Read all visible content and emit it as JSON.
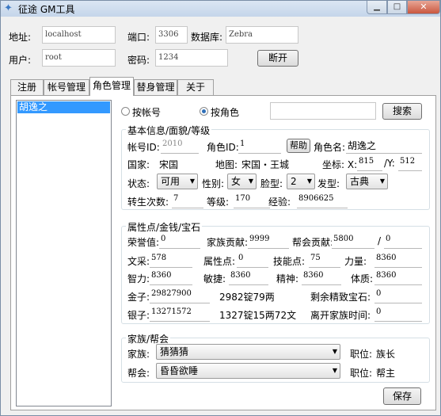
{
  "window": {
    "title": "征途 GM工具"
  },
  "connection": {
    "address_label": "地址:",
    "address_value": "localhost",
    "port_label": "端口:",
    "port_value": "3306",
    "db_label": "数据库:",
    "db_value": "Zebra",
    "user_label": "用户:",
    "user_value": "root",
    "password_label": "密码:",
    "password_value": "1234",
    "disconnect_label": "断开"
  },
  "tabs": [
    "注册",
    "帐号管理",
    "角色管理",
    "替身管理",
    "关于"
  ],
  "roles_list": [
    "胡逸之"
  ],
  "search": {
    "by_account_label": "按帐号",
    "by_role_label": "按角色",
    "query_value": "",
    "search_label": "搜索"
  },
  "basic": {
    "group_title": "基本信息/面貌/等级",
    "account_id_label": "帐号ID:",
    "account_id_value": "2010",
    "role_id_label": "角色ID:",
    "role_id_value": "1",
    "help_label": "帮助",
    "role_name_label": "角色名:",
    "role_name_value": "胡逸之",
    "country_label": "国家:",
    "country_value": "宋国",
    "map_label": "地图:",
    "map_value": "宋国・王城",
    "coord_label": "坐标: X:",
    "x_value": "815",
    "y_label": "/Y:",
    "y_value": "512",
    "status_label": "状态:",
    "status_value": "可用",
    "gender_label": "性别:",
    "gender_value": "女",
    "face_label": "脸型:",
    "face_value": "2",
    "hair_label": "发型:",
    "hair_value": "古典",
    "rebirth_label": "转生次数:",
    "rebirth_value": "7",
    "level_label": "等级:",
    "level_value": "170",
    "exp_label": "经验:",
    "exp_value": "8906625"
  },
  "attrs": {
    "group_title": "属性点/金钱/宝石",
    "honor_label": "荣誉值:",
    "honor_value": "0",
    "family_contrib_label": "家族贡献:",
    "family_contrib_value": "9999",
    "guild_contrib_label": "帮会贡献:",
    "guild_contrib_value": "5800",
    "guild_contrib_sep": "/",
    "guild_contrib_value2": "0",
    "literacy_label": "文采:",
    "literacy_value": "578",
    "attr_points_label": "属性点:",
    "attr_points_value": "0",
    "skill_points_label": "技能点:",
    "skill_points_value": "75",
    "strength_label": "力量:",
    "strength_value": "8360",
    "intel_label": "智力:",
    "intel_value": "8360",
    "agility_label": "敏捷:",
    "agility_value": "8360",
    "spirit_label": "精神:",
    "spirit_value": "8360",
    "stamina_label": "体质:",
    "stamina_value": "8360",
    "gold_label": "金子:",
    "gold_value": "29827900",
    "gold_text": "2982锭79两",
    "refined_gem_label": "剩余精致宝石:",
    "refined_gem_value": "0",
    "silver_label": "银子:",
    "silver_value": "13271572",
    "silver_text": "1327锭15两72文",
    "leave_family_label": "离开家族时间:",
    "leave_family_value": "0"
  },
  "family": {
    "group_title": "家族/帮会",
    "family_label": "家族:",
    "family_value": "猜猜猜",
    "family_pos_label": "职位:",
    "family_pos_value": "族长",
    "guild_label": "帮会:",
    "guild_value": "昏昏欲睡",
    "guild_pos_label": "职位:",
    "guild_pos_value": "帮主"
  },
  "save_label": "保存"
}
